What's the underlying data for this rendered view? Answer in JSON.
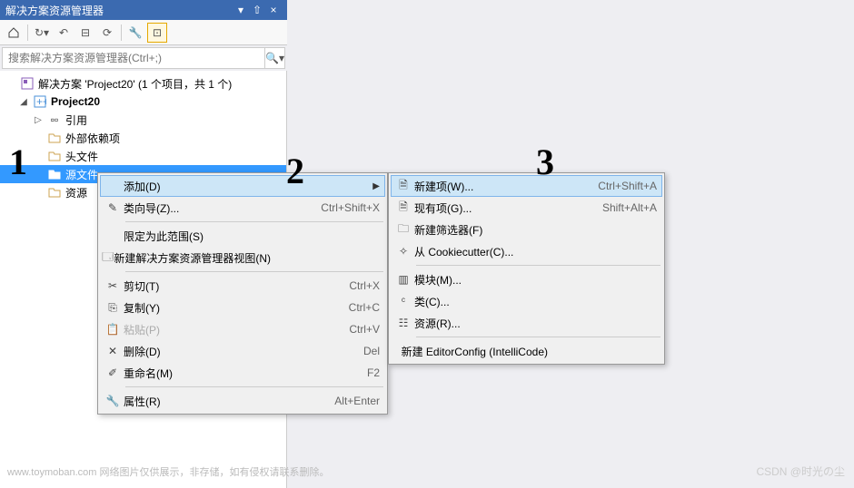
{
  "panel": {
    "title": "解决方案资源管理器",
    "search_placeholder": "搜索解决方案资源管理器(Ctrl+;)"
  },
  "tree": {
    "root": "解决方案 'Project20' (1 个项目，共 1 个)",
    "project": "Project20",
    "references": "引用",
    "external": "外部依赖项",
    "headers": "头文件",
    "sources": "源文件",
    "resources": "资源"
  },
  "menu1": {
    "add": "添加(D)",
    "wizard": "类向导(Z)...",
    "wizard_sc": "Ctrl+Shift+X",
    "scope": "限定为此范围(S)",
    "newview": "新建解决方案资源管理器视图(N)",
    "cut": "剪切(T)",
    "cut_sc": "Ctrl+X",
    "copy": "复制(Y)",
    "copy_sc": "Ctrl+C",
    "paste": "粘贴(P)",
    "paste_sc": "Ctrl+V",
    "delete": "删除(D)",
    "delete_sc": "Del",
    "rename": "重命名(M)",
    "rename_sc": "F2",
    "props": "属性(R)",
    "props_sc": "Alt+Enter"
  },
  "menu2": {
    "newitem": "新建项(W)...",
    "newitem_sc": "Ctrl+Shift+A",
    "existing": "现有项(G)...",
    "existing_sc": "Shift+Alt+A",
    "newfilter": "新建筛选器(F)",
    "cookiecutter": "从 Cookiecutter(C)...",
    "module": "模块(M)...",
    "class": "类(C)...",
    "resource": "资源(R)...",
    "editorconfig": "新建 EditorConfig (IntelliCode)"
  },
  "annotations": {
    "one": "1",
    "two": "2",
    "three": "3"
  },
  "footer": {
    "left": "www.toymoban.com  网络图片仅供展示，非存储，如有侵权请联系删除。",
    "right": "CSDN @时光の尘"
  }
}
